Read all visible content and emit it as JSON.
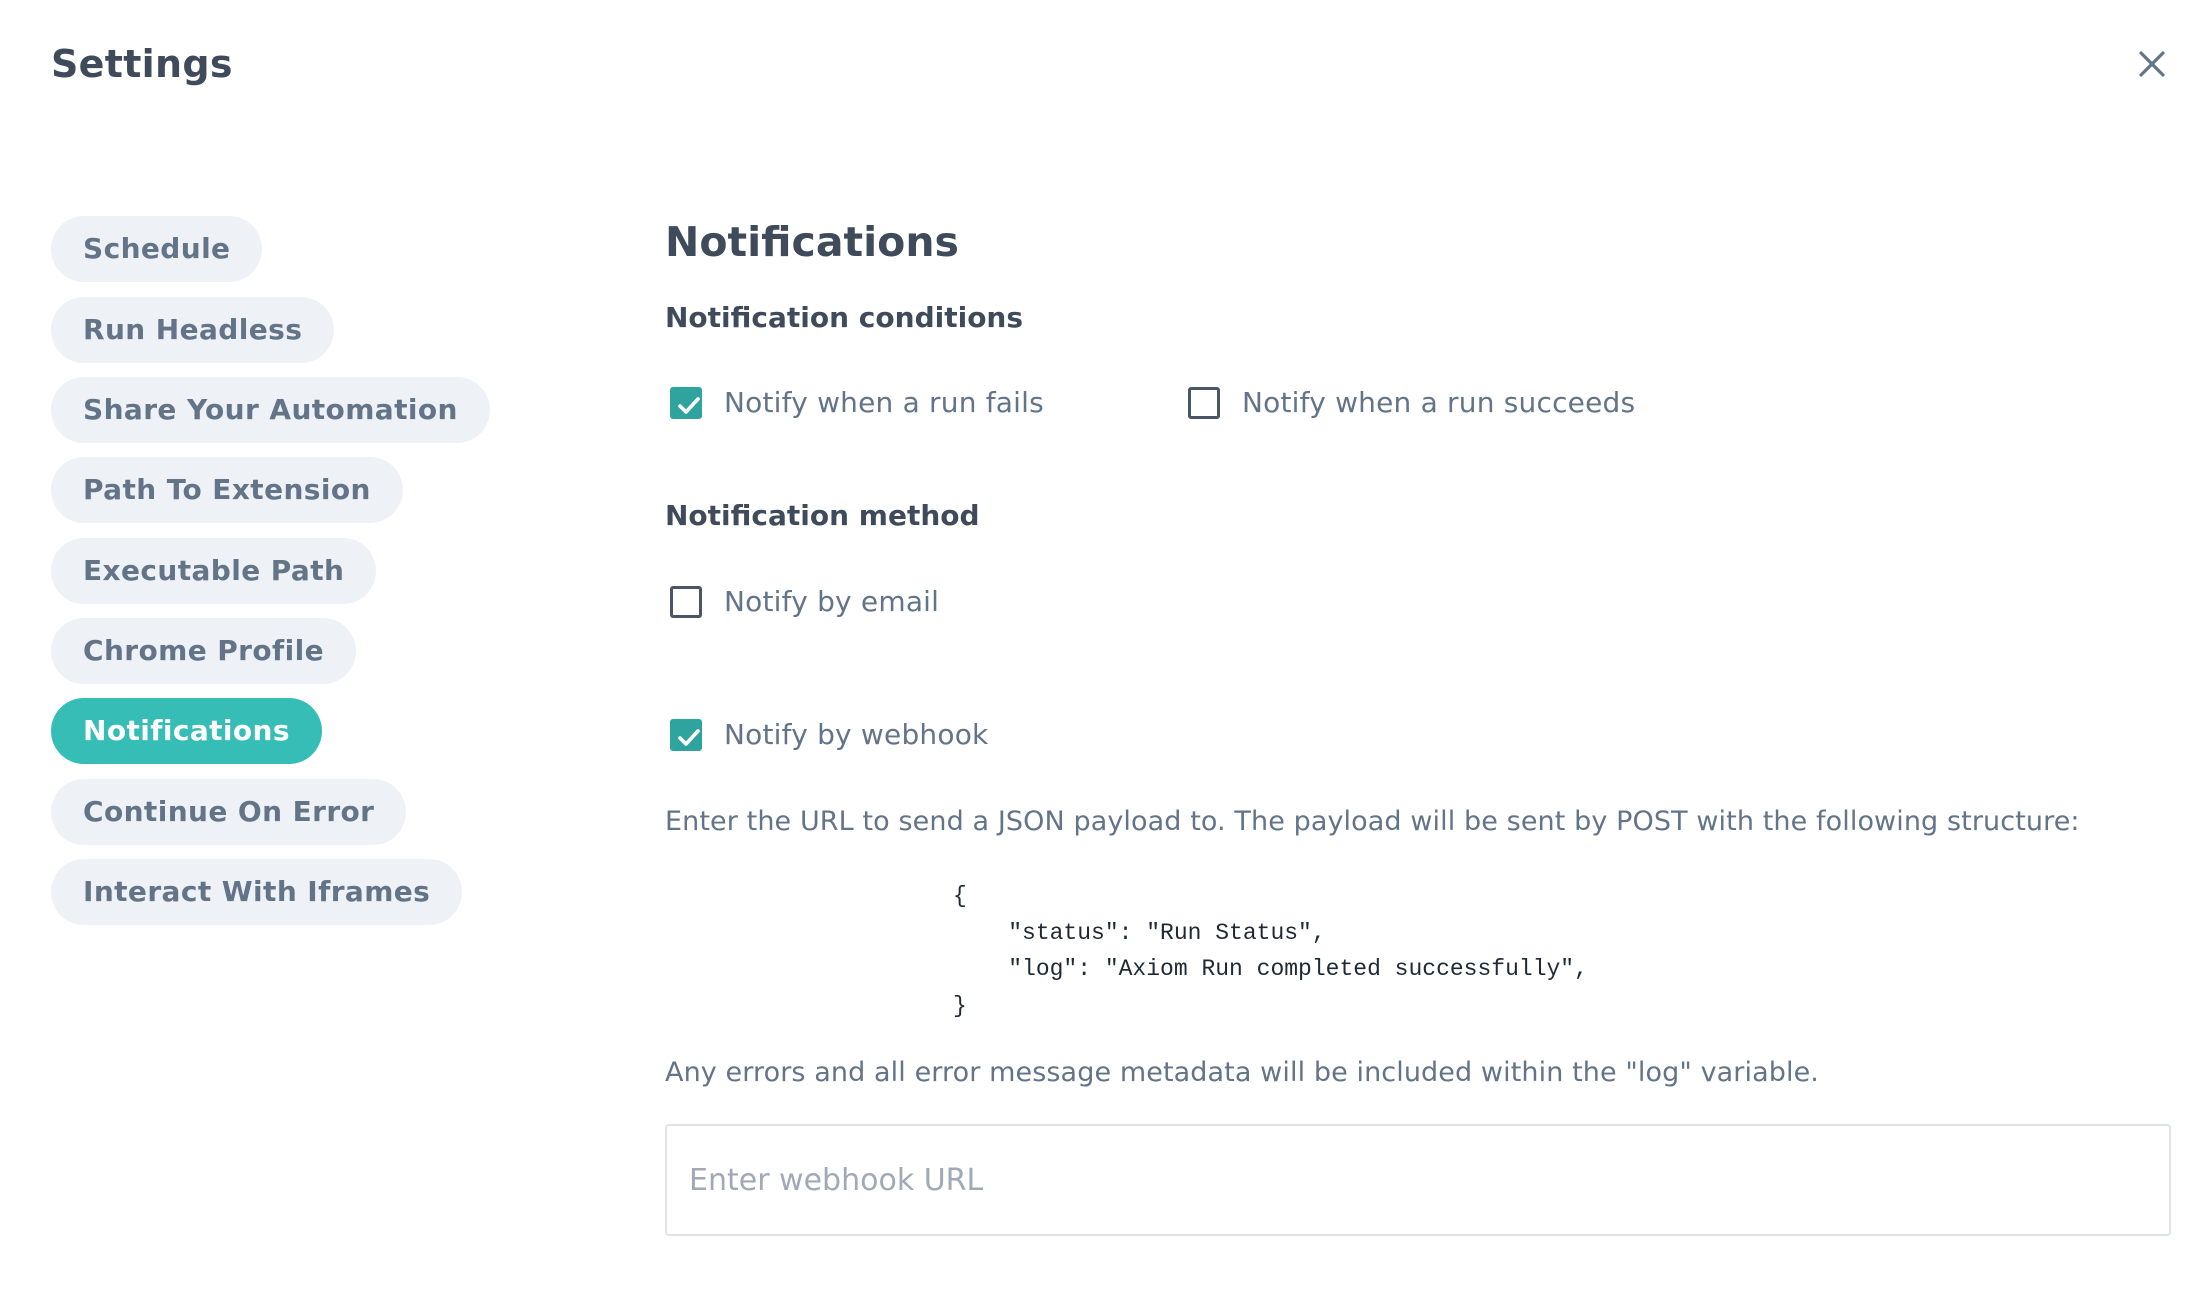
{
  "header": {
    "title": "Settings",
    "close_icon": "close-icon"
  },
  "sidebar": {
    "items": [
      {
        "label": "Schedule",
        "active": false
      },
      {
        "label": "Run Headless",
        "active": false
      },
      {
        "label": "Share Your Automation",
        "active": false
      },
      {
        "label": "Path To Extension",
        "active": false
      },
      {
        "label": "Executable Path",
        "active": false
      },
      {
        "label": "Chrome Profile",
        "active": false
      },
      {
        "label": "Notifications",
        "active": true
      },
      {
        "label": "Continue On Error",
        "active": false
      },
      {
        "label": "Interact With Iframes",
        "active": false
      }
    ]
  },
  "main": {
    "section_title": "Notifications",
    "conditions": {
      "heading": "Notification conditions",
      "fails": {
        "label": "Notify when a run fails",
        "checked": true
      },
      "succeeds": {
        "label": "Notify when a run succeeds",
        "checked": false
      }
    },
    "method": {
      "heading": "Notification method",
      "email": {
        "label": "Notify by email",
        "checked": false
      },
      "webhook": {
        "label": "Notify by webhook",
        "checked": true
      }
    },
    "webhook_description": "Enter the URL to send a JSON payload to. The payload will be sent by POST with the following structure:",
    "payload_example": "{\n    \"status\": \"Run Status\",\n    \"log\": \"Axiom Run completed successfully\",\n}",
    "log_note": "Any errors and all error message metadata will be included within the \"log\" variable.",
    "webhook_input": {
      "value": "",
      "placeholder": "Enter webhook URL"
    }
  },
  "colors": {
    "accent": "#36bdb6",
    "checkbox_checked": "#2fa39d",
    "nav_bg": "#eef1f5",
    "text_muted": "#637488",
    "text_dark": "#3f4a5a"
  }
}
